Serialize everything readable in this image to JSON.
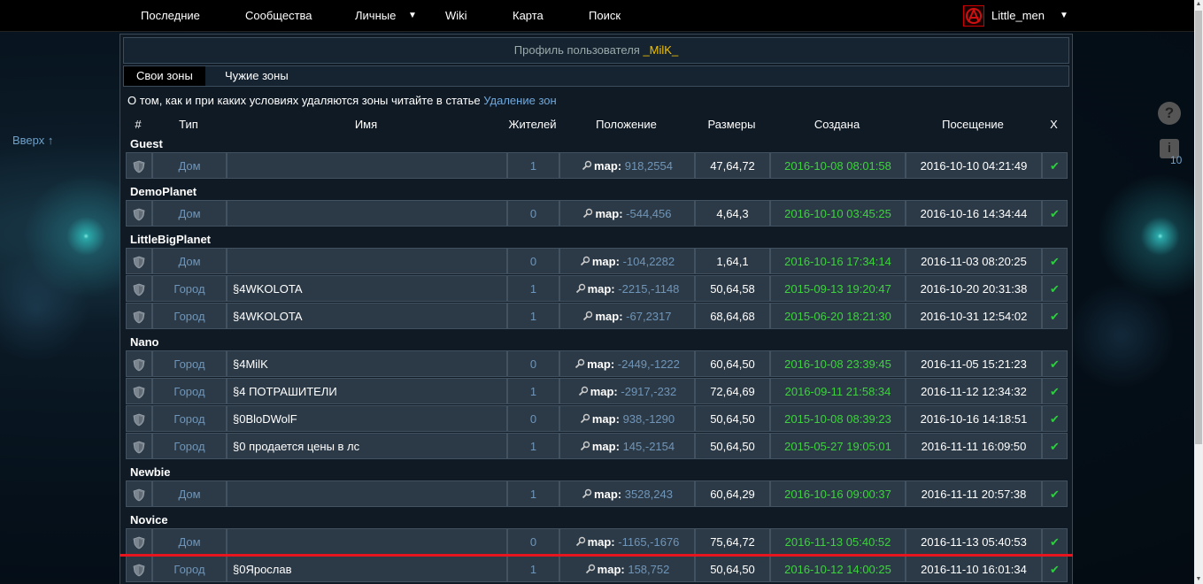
{
  "nav": {
    "items": [
      "Последние",
      "Сообщества",
      "Личные",
      "Wiki",
      "Карта",
      "Поиск"
    ],
    "username": "Little_men"
  },
  "side": {
    "back_to_top": "Вверх ↑",
    "help": "?",
    "info": "i",
    "info_count": "10"
  },
  "profile": {
    "title_prefix": "Профиль пользователя ",
    "username": "_MilK_"
  },
  "tabs": [
    "Свои зоны",
    "Чужие зоны"
  ],
  "notice": {
    "text": "О том, как и при каких условиях удаляются зоны читайте в статье ",
    "link": "Удаление зон"
  },
  "columns": [
    "#",
    "Тип",
    "Имя",
    "Жителей",
    "Положение",
    "Размеры",
    "Создана",
    "Посещение",
    "X"
  ],
  "map_label": "map:",
  "check": "✔",
  "groups": [
    {
      "name": "Guest",
      "rows": [
        {
          "type": "Дом",
          "name": "",
          "pop": "1",
          "coords": "918,2554",
          "size": "47,64,72",
          "created": "2016-10-08 08:01:58",
          "visit": "2016-10-10 04:21:49"
        }
      ]
    },
    {
      "name": "DemoPlanet",
      "rows": [
        {
          "type": "Дом",
          "name": "",
          "pop": "0",
          "coords": "-544,456",
          "size": "4,64,3",
          "created": "2016-10-10 03:45:25",
          "visit": "2016-10-16 14:34:44"
        }
      ]
    },
    {
      "name": "LittleBigPlanet",
      "rows": [
        {
          "type": "Дом",
          "name": "",
          "pop": "0",
          "coords": "-104,2282",
          "size": "1,64,1",
          "created": "2016-10-16 17:34:14",
          "visit": "2016-11-03 08:20:25"
        },
        {
          "type": "Город",
          "name": "§4WKOLOTA",
          "pop": "1",
          "coords": "-2215,-1148",
          "size": "50,64,58",
          "created": "2015-09-13 19:20:47",
          "visit": "2016-10-20 20:31:38"
        },
        {
          "type": "Город",
          "name": "§4WKOLOTA",
          "pop": "1",
          "coords": "-67,2317",
          "size": "68,64,68",
          "created": "2015-06-20 18:21:30",
          "visit": "2016-10-31 12:54:02"
        }
      ]
    },
    {
      "name": "Nano",
      "rows": [
        {
          "type": "Город",
          "name": "§4MilK",
          "pop": "0",
          "coords": "-2449,-1222",
          "size": "60,64,50",
          "created": "2016-10-08 23:39:45",
          "visit": "2016-11-05 15:21:23"
        },
        {
          "type": "Город",
          "name": "§4 ПОТРАШИТЕЛИ",
          "pop": "1",
          "coords": "-2917,-232",
          "size": "72,64,69",
          "created": "2016-09-11 21:58:34",
          "visit": "2016-11-12 12:34:32"
        },
        {
          "type": "Город",
          "name": "§0BloDWolF",
          "pop": "0",
          "coords": "938,-1290",
          "size": "50,64,50",
          "created": "2015-10-08 08:39:23",
          "visit": "2016-10-16 14:18:51"
        },
        {
          "type": "Город",
          "name": "§0 продается цены в лс",
          "pop": "1",
          "coords": "145,-2154",
          "size": "50,64,50",
          "created": "2015-05-27 19:05:01",
          "visit": "2016-11-11 16:09:50"
        }
      ]
    },
    {
      "name": "Newbie",
      "rows": [
        {
          "type": "Дом",
          "name": "",
          "pop": "1",
          "coords": "3528,243",
          "size": "60,64,29",
          "created": "2016-10-16 09:00:37",
          "visit": "2016-11-11 20:57:38"
        }
      ]
    },
    {
      "name": "Novice",
      "rows": [
        {
          "type": "Дом",
          "name": "",
          "pop": "0",
          "coords": "-1165,-1676",
          "size": "75,64,72",
          "created": "2016-11-13 05:40:52",
          "visit": "2016-11-13 05:40:53"
        },
        {
          "type": "Город",
          "name": "§0Ярослав",
          "pop": "1",
          "coords": "158,752",
          "size": "50,64,50",
          "created": "2016-10-12 14:00:25",
          "visit": "2016-11-10 16:01:34"
        }
      ]
    }
  ],
  "colors": {
    "created": "#3cd33c",
    "link": "#6fa8dc",
    "username": "#f0c000",
    "highlight": "#e8141e",
    "check": "#2ecc40"
  }
}
